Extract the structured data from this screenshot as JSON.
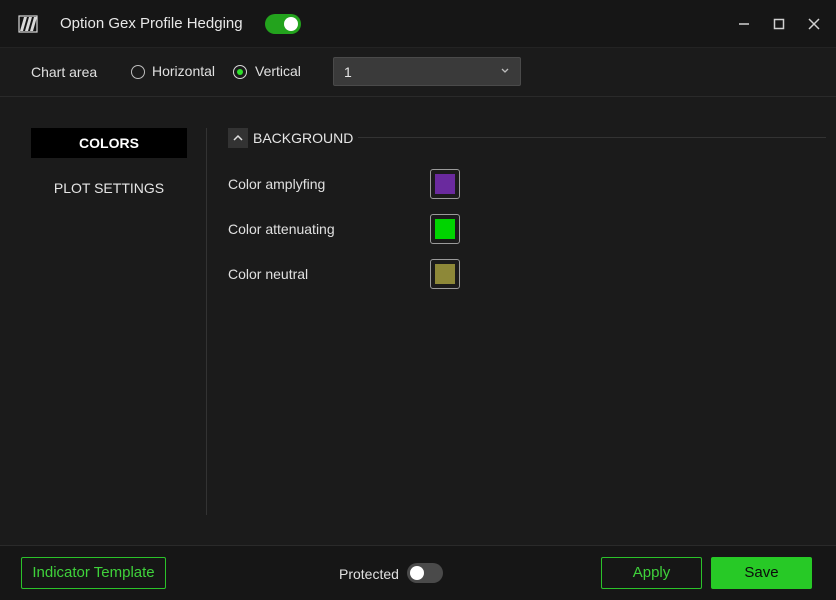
{
  "window": {
    "title": "Option Gex Profile Hedging",
    "enabled_toggle": true
  },
  "toolbar": {
    "chart_area_label": "Chart area",
    "orientation_options": [
      "Horizontal",
      "Vertical"
    ],
    "orientation_selected": "Vertical",
    "select_value": "1"
  },
  "sidebar": {
    "items": [
      {
        "label": "COLORS",
        "active": true
      },
      {
        "label": "PLOT SETTINGS",
        "active": false
      }
    ]
  },
  "section": {
    "title": "BACKGROUND",
    "expanded": true,
    "rows": [
      {
        "label": "Color amplyfing",
        "color": "#6a2a9e"
      },
      {
        "label": "Color attenuating",
        "color": "#00d400"
      },
      {
        "label": "Color neutral",
        "color": "#8d8838"
      }
    ]
  },
  "footer": {
    "indicator_template_label": "Indicator Template",
    "protected_label": "Protected",
    "protected_toggle": false,
    "apply_label": "Apply",
    "save_label": "Save"
  },
  "icons": {
    "logo": "app-logo-icon",
    "minimize": "minimize-icon",
    "maximize": "maximize-icon",
    "close": "close-icon",
    "dropdown": "chevron-down-icon",
    "collapse": "chevron-up-icon"
  },
  "theme": {
    "accent": "#27c926",
    "background": "#1b1b1b"
  }
}
